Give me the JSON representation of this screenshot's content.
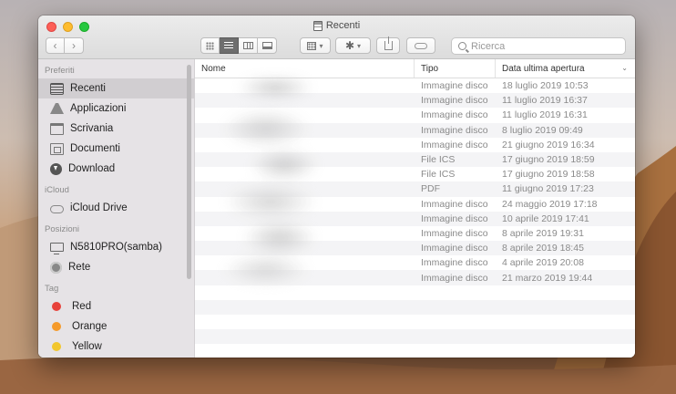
{
  "window": {
    "title": "Recenti"
  },
  "toolbar": {
    "search_placeholder": "Ricerca",
    "search_value": ""
  },
  "sidebar": {
    "sections": [
      {
        "title": "Preferiti",
        "items": [
          {
            "label": "Recenti",
            "icon": "recent-icon",
            "selected": true
          },
          {
            "label": "Applicazioni",
            "icon": "applications-icon"
          },
          {
            "label": "Scrivania",
            "icon": "desktop-icon"
          },
          {
            "label": "Documenti",
            "icon": "documents-icon"
          },
          {
            "label": "Download",
            "icon": "download-icon"
          }
        ]
      },
      {
        "title": "iCloud",
        "items": [
          {
            "label": "iCloud Drive",
            "icon": "cloud-icon"
          }
        ]
      },
      {
        "title": "Posizioni",
        "items": [
          {
            "label": "N5810PRO(samba)",
            "icon": "computer-icon"
          },
          {
            "label": "Rete",
            "icon": "network-icon"
          }
        ]
      },
      {
        "title": "Tag",
        "items": [
          {
            "label": "Red",
            "color": "#e8423b"
          },
          {
            "label": "Orange",
            "color": "#f59a2a"
          },
          {
            "label": "Yellow",
            "color": "#f2c62d"
          }
        ]
      }
    ]
  },
  "table": {
    "columns": {
      "name": "Nome",
      "kind": "Tipo",
      "date": "Data ultima apertura"
    },
    "rows": [
      {
        "kind": "Immagine disco",
        "date": "18 luglio 2019 10:53"
      },
      {
        "kind": "Immagine disco",
        "date": "11 luglio 2019 16:37"
      },
      {
        "kind": "Immagine disco",
        "date": "11 luglio 2019 16:31"
      },
      {
        "kind": "Immagine disco",
        "date": "8 luglio 2019 09:49"
      },
      {
        "kind": "Immagine disco",
        "date": "21 giugno 2019 16:34"
      },
      {
        "kind": "File ICS",
        "date": "17 giugno 2019 18:59"
      },
      {
        "kind": "File ICS",
        "date": "17 giugno 2019 18:58"
      },
      {
        "kind": "PDF",
        "date": "11 giugno 2019 17:23"
      },
      {
        "kind": "Immagine disco",
        "date": "24 maggio 2019 17:18"
      },
      {
        "kind": "Immagine disco",
        "date": "10 aprile 2019 17:41"
      },
      {
        "kind": "Immagine disco",
        "date": "8 aprile 2019 19:31"
      },
      {
        "kind": "Immagine disco",
        "date": "8 aprile 2019 18:45"
      },
      {
        "kind": "Immagine disco",
        "date": "4 aprile 2019 20:08"
      },
      {
        "kind": "Immagine disco",
        "date": "21 marzo 2019 19:44"
      }
    ],
    "empty_rows": 6
  }
}
